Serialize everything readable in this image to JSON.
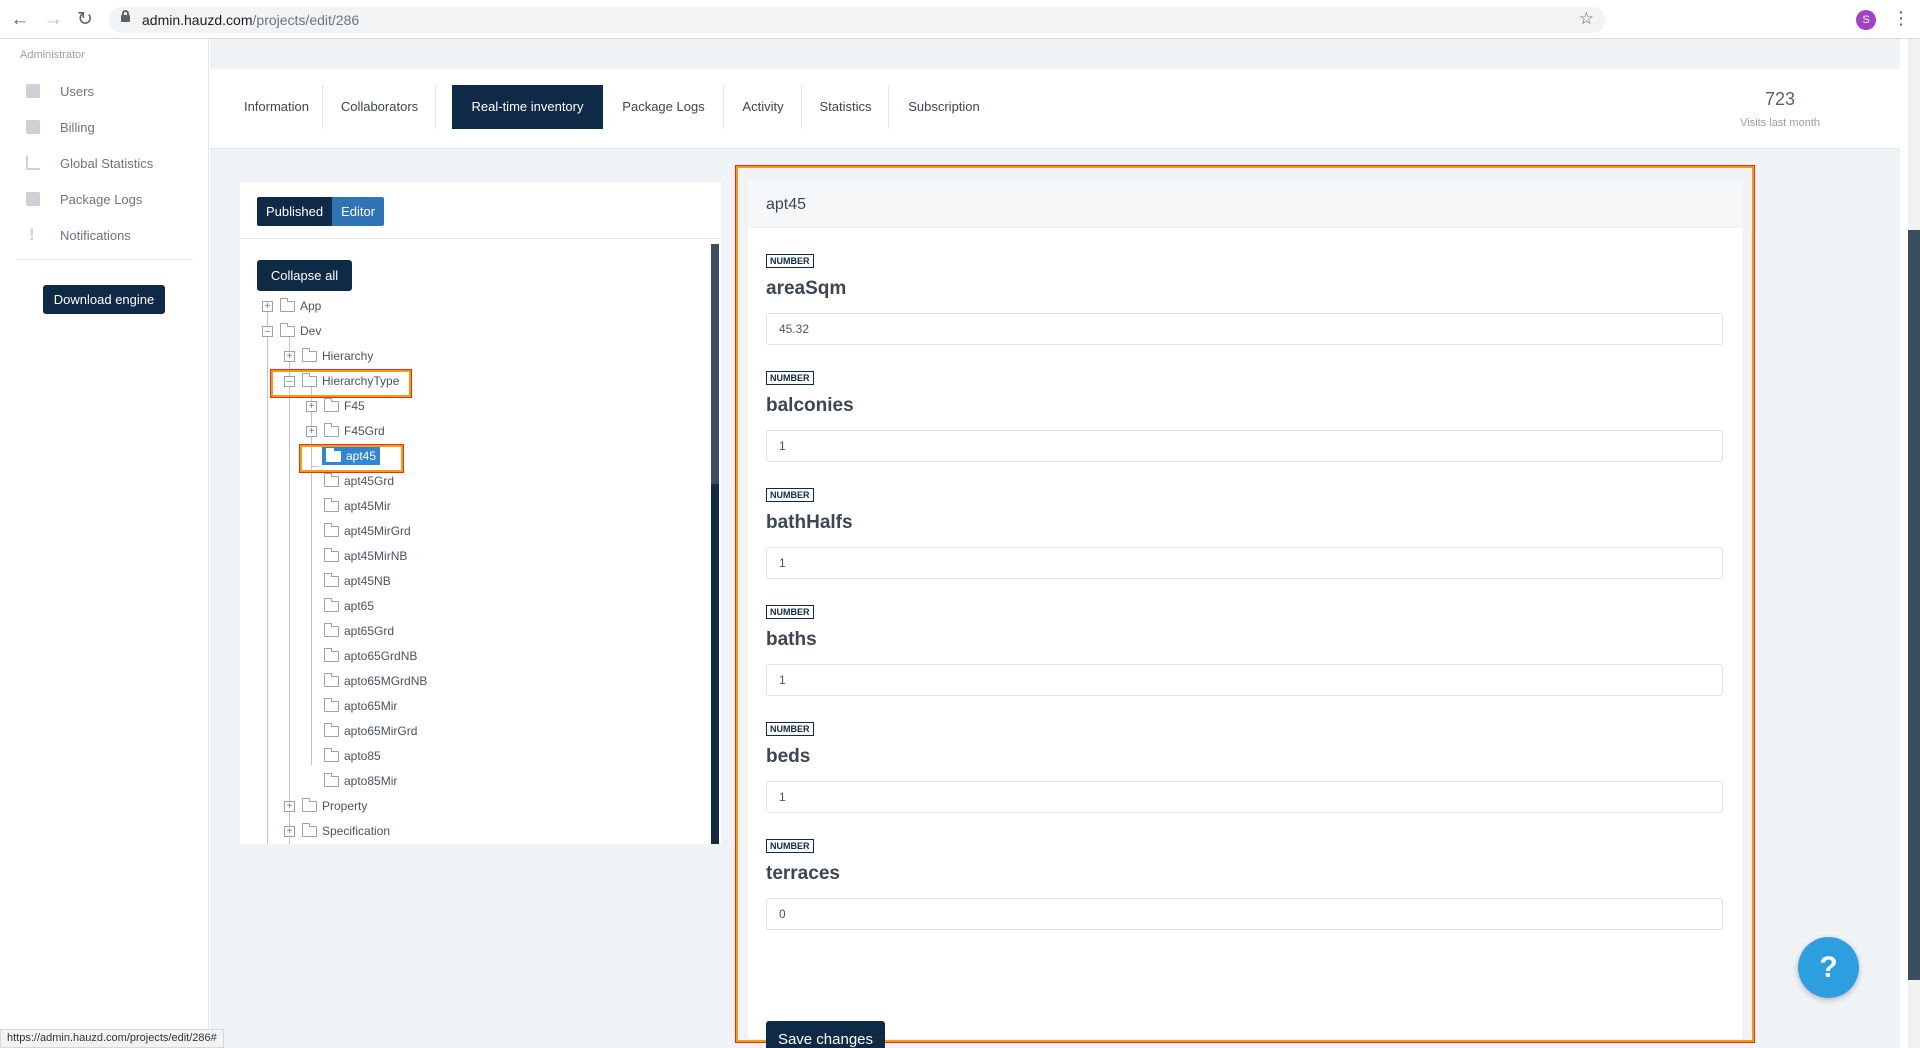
{
  "browser": {
    "url_host": "admin.hauzd.com",
    "url_path": "/projects/edit/286",
    "profile_initial": "S",
    "status_url": "https://admin.hauzd.com/projects/edit/286#"
  },
  "sidebar": {
    "role": "Administrator",
    "items": [
      {
        "label": "Users",
        "icon": "user-icon"
      },
      {
        "label": "Billing",
        "icon": "billing-icon"
      },
      {
        "label": "Global Statistics",
        "icon": "chart-icon"
      },
      {
        "label": "Package Logs",
        "icon": "package-icon"
      },
      {
        "label": "Notifications",
        "icon": "alert-icon"
      }
    ],
    "download_label": "Download engine"
  },
  "tabs": [
    {
      "label": "Information"
    },
    {
      "label": "Collaborators"
    },
    {
      "label": "Real-time inventory",
      "active": true
    },
    {
      "label": "Package Logs"
    },
    {
      "label": "Activity"
    },
    {
      "label": "Statistics"
    },
    {
      "label": "Subscription"
    }
  ],
  "visits": {
    "value": "723",
    "label": "Visits last month"
  },
  "tree": {
    "toggle": {
      "published": "Published",
      "editor": "Editor"
    },
    "collapse_label": "Collapse all",
    "nodes": [
      {
        "label": "App"
      },
      {
        "label": "Dev"
      },
      {
        "label": "Hierarchy"
      },
      {
        "label": "HierarchyType"
      },
      {
        "label": "F45"
      },
      {
        "label": "F45Grd"
      },
      {
        "label": "apt45",
        "selected": true
      },
      {
        "label": "apt45Grd"
      },
      {
        "label": "apt45Mir"
      },
      {
        "label": "apt45MirGrd"
      },
      {
        "label": "apt45MirNB"
      },
      {
        "label": "apt45NB"
      },
      {
        "label": "apt65"
      },
      {
        "label": "apt65Grd"
      },
      {
        "label": "apto65GrdNB"
      },
      {
        "label": "apto65MGrdNB"
      },
      {
        "label": "apto65Mir"
      },
      {
        "label": "apto65MirGrd"
      },
      {
        "label": "apto85"
      },
      {
        "label": "apto85Mir"
      },
      {
        "label": "Property"
      },
      {
        "label": "Specification"
      }
    ]
  },
  "form": {
    "title": "apt45",
    "fields": [
      {
        "type": "NUMBER",
        "name": "areaSqm",
        "value": "45.32"
      },
      {
        "type": "NUMBER",
        "name": "balconies",
        "value": "1"
      },
      {
        "type": "NUMBER",
        "name": "bathHalfs",
        "value": "1"
      },
      {
        "type": "NUMBER",
        "name": "baths",
        "value": "1"
      },
      {
        "type": "NUMBER",
        "name": "beds",
        "value": "1"
      },
      {
        "type": "NUMBER",
        "name": "terraces",
        "value": "0"
      }
    ],
    "save_label": "Save changes"
  },
  "help_label": "?"
}
